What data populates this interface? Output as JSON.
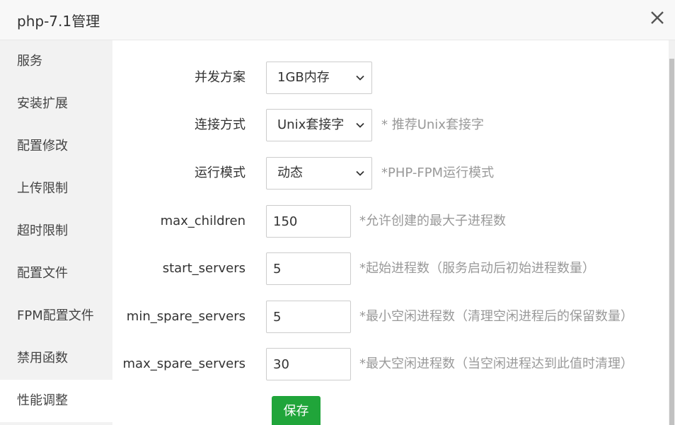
{
  "window": {
    "title": "php-7.1管理",
    "close_icon": "close-icon"
  },
  "sidebar": {
    "items": [
      {
        "label": "服务"
      },
      {
        "label": "安装扩展"
      },
      {
        "label": "配置修改"
      },
      {
        "label": "上传限制"
      },
      {
        "label": "超时限制"
      },
      {
        "label": "配置文件"
      },
      {
        "label": "FPM配置文件"
      },
      {
        "label": "禁用函数"
      },
      {
        "label": "性能调整",
        "active": true
      }
    ]
  },
  "form": {
    "concurrency": {
      "label": "并发方案",
      "value": "1GB内存"
    },
    "connection": {
      "label": "连接方式",
      "value": "Unix套接字",
      "hint": "* 推荐Unix套接字"
    },
    "run_mode": {
      "label": "运行模式",
      "value": "动态",
      "hint": "*PHP-FPM运行模式"
    },
    "max_children": {
      "label": "max_children",
      "value": "150",
      "hint": "*允许创建的最大子进程数"
    },
    "start_servers": {
      "label": "start_servers",
      "value": "5",
      "hint": "*起始进程数（服务启动后初始进程数量）"
    },
    "min_spare_servers": {
      "label": "min_spare_servers",
      "value": "5",
      "hint": "*最小空闲进程数（清理空闲进程后的保留数量）"
    },
    "max_spare_servers": {
      "label": "max_spare_servers",
      "value": "30",
      "hint": "*最大空闲进程数（当空闲进程达到此值时清理）"
    },
    "save_label": "保存"
  },
  "colors": {
    "accent": "#20a53a",
    "sidebar_bg": "#f2f2f2",
    "hint": "#999999"
  }
}
